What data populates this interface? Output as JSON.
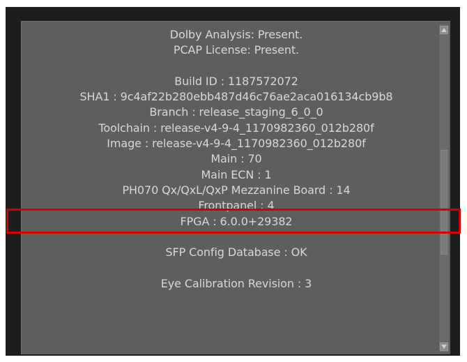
{
  "info_panel": {
    "lines": [
      "Dolby Analysis: Present.",
      "PCAP License: Present.",
      "",
      "Build ID : 1187572072",
      "SHA1 : 9c4af22b280ebb487d46c76ae2aca016134cb9b8",
      "Branch : release_staging_6_0_0",
      "Toolchain : release-v4-9-4_1170982360_012b280f",
      "Image : release-v4-9-4_1170982360_012b280f",
      "Main : 70",
      "Main ECN : 1",
      "PH070 Qx/QxL/QxP Mezzanine Board : 14",
      "Frontpanel : 4",
      "FPGA : 6.0.0+29382",
      "",
      "SFP Config Database : OK",
      "",
      "Eye Calibration Revision : 3"
    ]
  },
  "highlight": {
    "color": "#d40000",
    "line_text": "PH070 Qx/QxL/QxP Mezzanine Board : 14"
  },
  "colors": {
    "panel_background": "#5e5e5e",
    "frame_background": "#1d1d1d",
    "text": "#d8d8d8"
  },
  "scrollbar": {
    "up_icon": "arrow-up-icon",
    "down_icon": "arrow-down-icon"
  }
}
